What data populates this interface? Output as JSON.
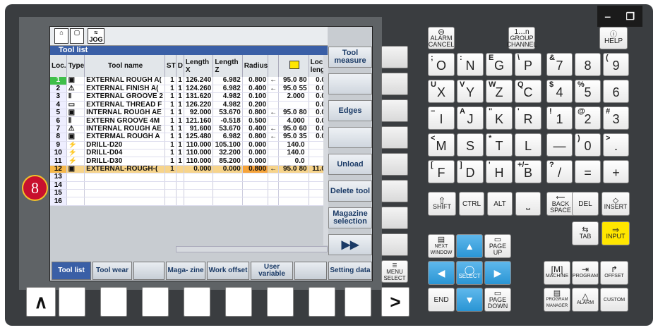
{
  "window": {
    "minimize": "‒",
    "restore": "❐"
  },
  "marker": "8",
  "toolbar": {
    "machine_icon": "machine-icon",
    "jog": "JOG"
  },
  "tool_list": {
    "title": "Tool list",
    "columns": [
      "Loc.",
      "Type",
      "Tool name",
      "ST",
      "D",
      "Length X",
      "Length Z",
      "Radius",
      "",
      "",
      "Loc. leng"
    ],
    "rows": [
      {
        "loc": "1",
        "type": "▣",
        "name": "EXTERNAL ROUGH A(",
        "st": "1",
        "d": "1",
        "lx": "126.240",
        "lz": "6.982",
        "r": "0.800",
        "dir": "←",
        "a": "95.0",
        "b": "80",
        "c": "0.0"
      },
      {
        "loc": "2",
        "type": "⚠",
        "name": "EXTERNAL FINISH A(",
        "st": "1",
        "d": "1",
        "lx": "124.260",
        "lz": "6.982",
        "r": "0.400",
        "dir": "←",
        "a": "95.0",
        "b": "55",
        "c": "0.0"
      },
      {
        "loc": "3",
        "type": "Ⅱ",
        "name": "EXTERNAL GROOVE 2",
        "st": "1",
        "d": "1",
        "lx": "131.620",
        "lz": "4.982",
        "r": "0.100",
        "dir": "",
        "a": "2.000",
        "b": "",
        "c": "0.0"
      },
      {
        "loc": "4",
        "type": "▭",
        "name": "EXTERNAL THREAD F",
        "st": "1",
        "d": "1",
        "lx": "126.220",
        "lz": "4.982",
        "r": "0.200",
        "dir": "",
        "a": "",
        "b": "",
        "c": "0.0"
      },
      {
        "loc": "5",
        "type": "▣",
        "name": "INTERNAL ROUGH AE",
        "st": "1",
        "d": "1",
        "lx": "92.000",
        "lz": "53.670",
        "r": "0.800",
        "dir": "←",
        "a": "95.0",
        "b": "80",
        "c": "0.0"
      },
      {
        "loc": "6",
        "type": "Ⅱ",
        "name": "EXTERN GROOVE 4M",
        "st": "1",
        "d": "1",
        "lx": "121.160",
        "lz": "-0.518",
        "r": "0.500",
        "dir": "",
        "a": "4.000",
        "b": "",
        "c": "0.0"
      },
      {
        "loc": "7",
        "type": "⚠",
        "name": "INTERNAL ROUGH AE",
        "st": "1",
        "d": "1",
        "lx": "91.600",
        "lz": "53.670",
        "r": "0.400",
        "dir": "←",
        "a": "95.0",
        "b": "60",
        "c": "0.0"
      },
      {
        "loc": "8",
        "type": "▣",
        "name": "EXTERMAL ROUGH A",
        "st": "1",
        "d": "1",
        "lx": "125.480",
        "lz": "6.982",
        "r": "0.800",
        "dir": "←",
        "a": "95.0",
        "b": "35",
        "c": "0.0"
      },
      {
        "loc": "9",
        "type": "⚡",
        "name": "DRILL-D20",
        "st": "1",
        "d": "1",
        "lx": "110.000",
        "lz": "105.100",
        "r": "0.000",
        "dir": "",
        "a": "140.0",
        "b": "",
        "c": ""
      },
      {
        "loc": "10",
        "type": "⚡",
        "name": "DRILL-D04",
        "st": "1",
        "d": "1",
        "lx": "110.000",
        "lz": "32.200",
        "r": "0.000",
        "dir": "",
        "a": "140.0",
        "b": "",
        "c": ""
      },
      {
        "loc": "11",
        "type": "⚡",
        "name": "DRILL-D30",
        "st": "1",
        "d": "1",
        "lx": "110.000",
        "lz": "85.200",
        "r": "0.000",
        "dir": "",
        "a": "0.0",
        "b": "",
        "c": ""
      },
      {
        "loc": "12",
        "type": "▣",
        "name": "EXTERNAL-ROUGH-(",
        "st": "1",
        "d": "",
        "lx": "0.000",
        "lz": "0.000",
        "r": "0.800",
        "dir": "←",
        "a": "95.0",
        "b": "80",
        "c": "11.0"
      },
      {
        "loc": "13",
        "type": "",
        "name": "",
        "st": "",
        "d": "",
        "lx": "",
        "lz": "",
        "r": "",
        "dir": "",
        "a": "",
        "b": "",
        "c": ""
      },
      {
        "loc": "14",
        "type": "",
        "name": "",
        "st": "",
        "d": "",
        "lx": "",
        "lz": "",
        "r": "",
        "dir": "",
        "a": "",
        "b": "",
        "c": ""
      },
      {
        "loc": "15",
        "type": "",
        "name": "",
        "st": "",
        "d": "",
        "lx": "",
        "lz": "",
        "r": "",
        "dir": "",
        "a": "",
        "b": "",
        "c": ""
      },
      {
        "loc": "16",
        "type": "",
        "name": "",
        "st": "",
        "d": "",
        "lx": "",
        "lz": "",
        "r": "",
        "dir": "",
        "a": "",
        "b": "",
        "c": ""
      }
    ]
  },
  "softkeys_v": [
    "Tool measure",
    "",
    "Edges",
    "",
    "Unload",
    "Delete tool",
    "Magazine selection",
    "▶▶"
  ],
  "softkeys_h": [
    "Tool list",
    "Tool wear",
    "",
    "Maga- zine",
    "Work offset",
    "User variable",
    "",
    "Setting data"
  ],
  "keypad": {
    "alarm_cancel": "ALARM CANCEL",
    "group_channel": "GROUP CHANNEL",
    "help": "HELP",
    "letters": [
      {
        "s": ";",
        "m": "O"
      },
      {
        "s": ":",
        "m": "N"
      },
      {
        "s": "E",
        "m": "G"
      },
      {
        "s": "\\",
        "m": "P"
      },
      {
        "s": "U",
        "m": "X"
      },
      {
        "s": "V",
        "m": "Y"
      },
      {
        "s": "W",
        "m": "Z"
      },
      {
        "s": "Q",
        "m": "C"
      },
      {
        "s": "−",
        "m": "I"
      },
      {
        "s": "A",
        "m": "J"
      },
      {
        "s": "\"",
        "m": "K"
      },
      {
        "s": "'",
        "m": "R"
      },
      {
        "s": "<",
        "m": "M"
      },
      {
        "s": "",
        "m": "S"
      },
      {
        "s": "*",
        "m": "T"
      },
      {
        "s": "",
        "m": "L"
      },
      {
        "s": "[",
        "m": "F"
      },
      {
        "s": "]",
        "m": "D"
      },
      {
        "s": "'",
        "m": "H"
      },
      {
        "s": "+/−",
        "m": "B"
      }
    ],
    "numbers": [
      {
        "s": "&",
        "m": "7"
      },
      {
        "s": "",
        "m": "8"
      },
      {
        "s": "(",
        "m": "9"
      },
      {
        "s": "$",
        "m": "4"
      },
      {
        "s": "%",
        "m": "5"
      },
      {
        "s": "",
        "m": "6"
      },
      {
        "s": "!",
        "m": "1"
      },
      {
        "s": "@",
        "m": "2"
      },
      {
        "s": "#",
        "m": "3"
      },
      {
        "s": "",
        "m": "—"
      },
      {
        "s": ")",
        "m": "0"
      },
      {
        "s": ">",
        "m": "."
      },
      {
        "s": "?",
        "m": "/"
      },
      {
        "s": "",
        "m": "="
      },
      {
        "s": "",
        "m": "+"
      }
    ],
    "shift": "SHIFT",
    "ctrl": "CTRL",
    "alt": "ALT",
    "space": "⎵",
    "backspace": "BACK SPACE",
    "del": "DEL",
    "insert": "INSERT",
    "tab": "TAB",
    "input": "INPUT",
    "next_window": "NEXT WINDOW",
    "page_up": "PAGE UP",
    "page_down": "PAGE DOWN",
    "select": "SELECT",
    "end": "END",
    "machine": "MACHINE",
    "program": "PROGRAM",
    "offset": "OFFSET",
    "program_manager": "PROGRAM MANAGER",
    "alarm": "ALARM",
    "custom": "CUSTOM",
    "menu_select": "MENU SELECT",
    "recall": "∧",
    "menu_next": ">"
  }
}
